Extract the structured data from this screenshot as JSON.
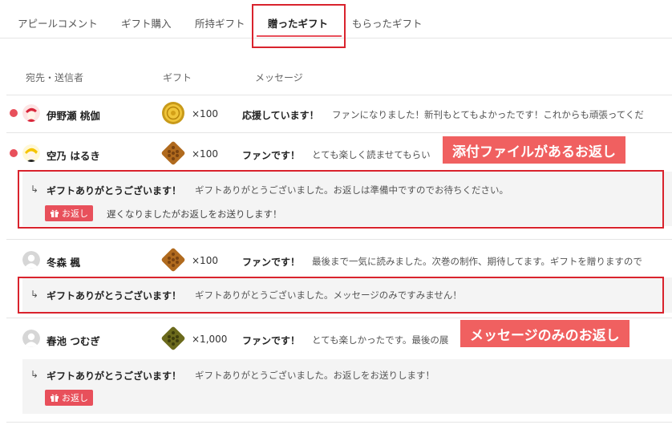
{
  "tabs": [
    {
      "label": "アピールコメント"
    },
    {
      "label": "ギフト購入"
    },
    {
      "label": "所持ギフト"
    },
    {
      "label": "贈ったギフト"
    },
    {
      "label": "もらったギフト"
    }
  ],
  "columns": {
    "recipient": "宛先・送信者",
    "gift": "ギフト",
    "message": "メッセージ"
  },
  "rows": [
    {
      "name": "伊野瀬 桃伽",
      "qty": "×100",
      "title": "応援しています！",
      "body": "ファンになりました！新刊もとてもよかったです！これからも頑張ってくだ"
    },
    {
      "name": "空乃 はるき",
      "qty": "×100",
      "title": "ファンです！",
      "body": "とても楽しく読ませてもらい",
      "reply": {
        "title": "ギフトありがとうございます！",
        "body": "ギフトありがとうございました。お返しは準備中ですのでお待ちください。",
        "button": "お返し",
        "note": "遅くなりましたがお返しをお送りします！"
      }
    },
    {
      "name": "冬森 楓",
      "qty": "×100",
      "title": "ファンです！",
      "body": "最後まで一気に読みました。次巻の制作、期待してます。ギフトを贈りますので",
      "reply": {
        "title": "ギフトありがとうございます！",
        "body": "ギフトありがとうございました。メッセージのみですみません！"
      }
    },
    {
      "name": "春池 つむぎ",
      "qty": "×1,000",
      "title": "ファンです！",
      "body": "とても楽しかったです。最後の展",
      "reply": {
        "title": "ギフトありがとうございます！",
        "body": "ギフトありがとうございました。お返しをお送りします！",
        "button": "お返し"
      }
    }
  ],
  "callouts": {
    "attachment": "添付ファイルがあるお返し",
    "message_only": "メッセージのみのお返し"
  },
  "colors": {
    "accent": "#e8505b",
    "highlight": "#d9232d",
    "callout": "#f06060"
  },
  "icons": {
    "reply": "reply-arrow-icon",
    "gift": "gift-box-icon",
    "coin": "gold-coin-icon",
    "waffle": "waffle-icon"
  }
}
